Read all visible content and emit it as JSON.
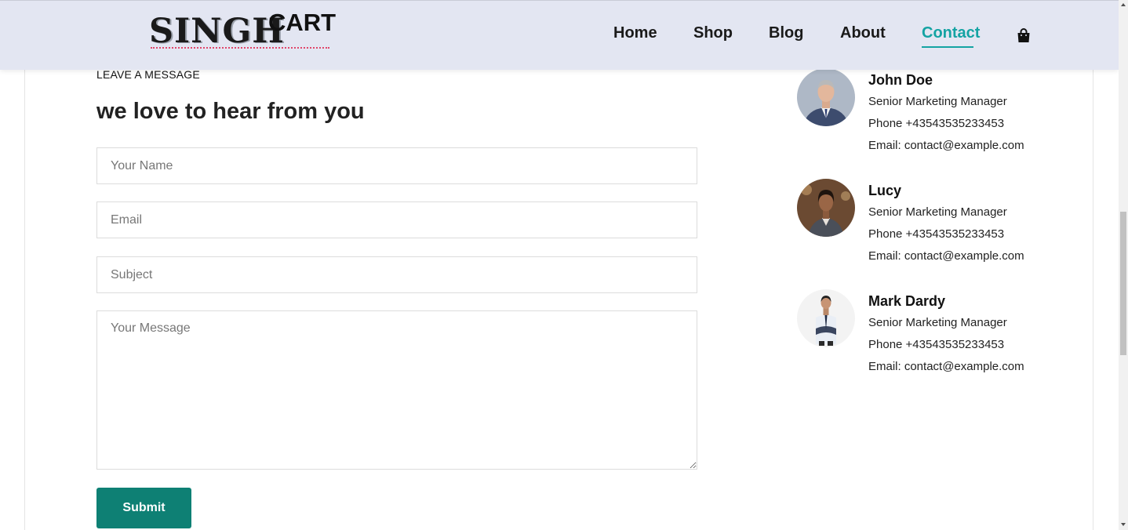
{
  "header": {
    "logo": {
      "primary": "SINGH",
      "secondary": "CART"
    },
    "nav": [
      {
        "label": "Home",
        "active": false
      },
      {
        "label": "Shop",
        "active": false
      },
      {
        "label": "Blog",
        "active": false
      },
      {
        "label": "About",
        "active": false
      },
      {
        "label": "Contact",
        "active": true
      }
    ],
    "cart_icon": "shopping-bag-icon"
  },
  "form": {
    "eyebrow": "LEAVE A MESSAGE",
    "title": "we love to hear from you",
    "name_placeholder": "Your Name",
    "email_placeholder": "Email",
    "subject_placeholder": "Subject",
    "message_placeholder": "Your Message",
    "submit_label": "Submit"
  },
  "contacts": [
    {
      "name": "John Doe",
      "role": "Senior Marketing Manager",
      "phone": "Phone +43543535233453",
      "email": "Email: contact@example.com"
    },
    {
      "name": "Lucy",
      "role": "Senior Marketing Manager",
      "phone": "Phone +43543535233453",
      "email": "Email: contact@example.com"
    },
    {
      "name": "Mark Dardy",
      "role": "Senior Marketing Manager",
      "phone": "Phone +43543535233453",
      "email": "Email: contact@example.com"
    }
  ],
  "colors": {
    "accent": "#14a3a3",
    "submit_bg": "#0e8074",
    "header_bg": "#e3e6f2"
  }
}
